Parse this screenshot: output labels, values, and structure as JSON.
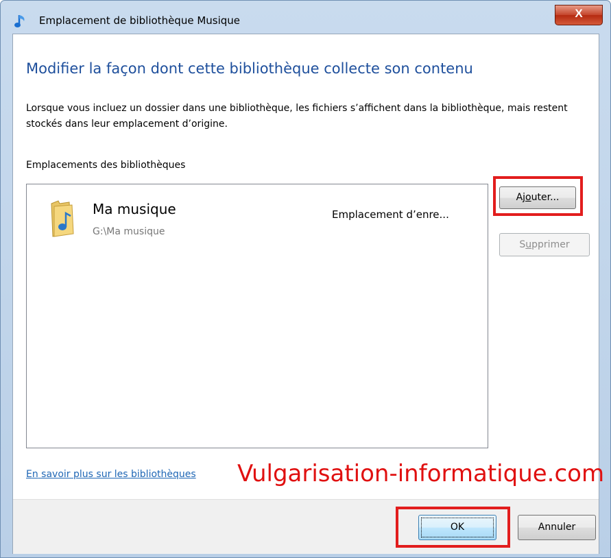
{
  "window": {
    "title": "Emplacement de bibliothèque Musique",
    "close_label": "X"
  },
  "content": {
    "heading": "Modifier la façon dont cette bibliothèque collecte son contenu",
    "description": "Lorsque vous incluez un dossier dans une bibliothèque, les fichiers s’affichent dans la bibliothèque, mais restent stockés dans leur emplacement d’origine.",
    "list_label": "Emplacements des bibliothèques"
  },
  "locations": [
    {
      "name": "Ma musique",
      "path": "G:\\Ma musique",
      "status": "Emplacement d’enre..."
    }
  ],
  "buttons": {
    "add": {
      "pre": "Aj",
      "accel": "o",
      "post": "uter..."
    },
    "remove": {
      "pre": "S",
      "accel": "u",
      "post": "pprimer"
    },
    "ok": "OK",
    "cancel": "Annuler"
  },
  "link": {
    "pre": "E",
    "accel": "n",
    "post": " savoir plus sur les bibliothèques"
  },
  "watermark": "Vulgarisation-informatique.com",
  "colors": {
    "heading": "#1e4f9c",
    "link": "#1e66b5",
    "highlight": "#e21d1d",
    "watermark": "#e01010"
  }
}
